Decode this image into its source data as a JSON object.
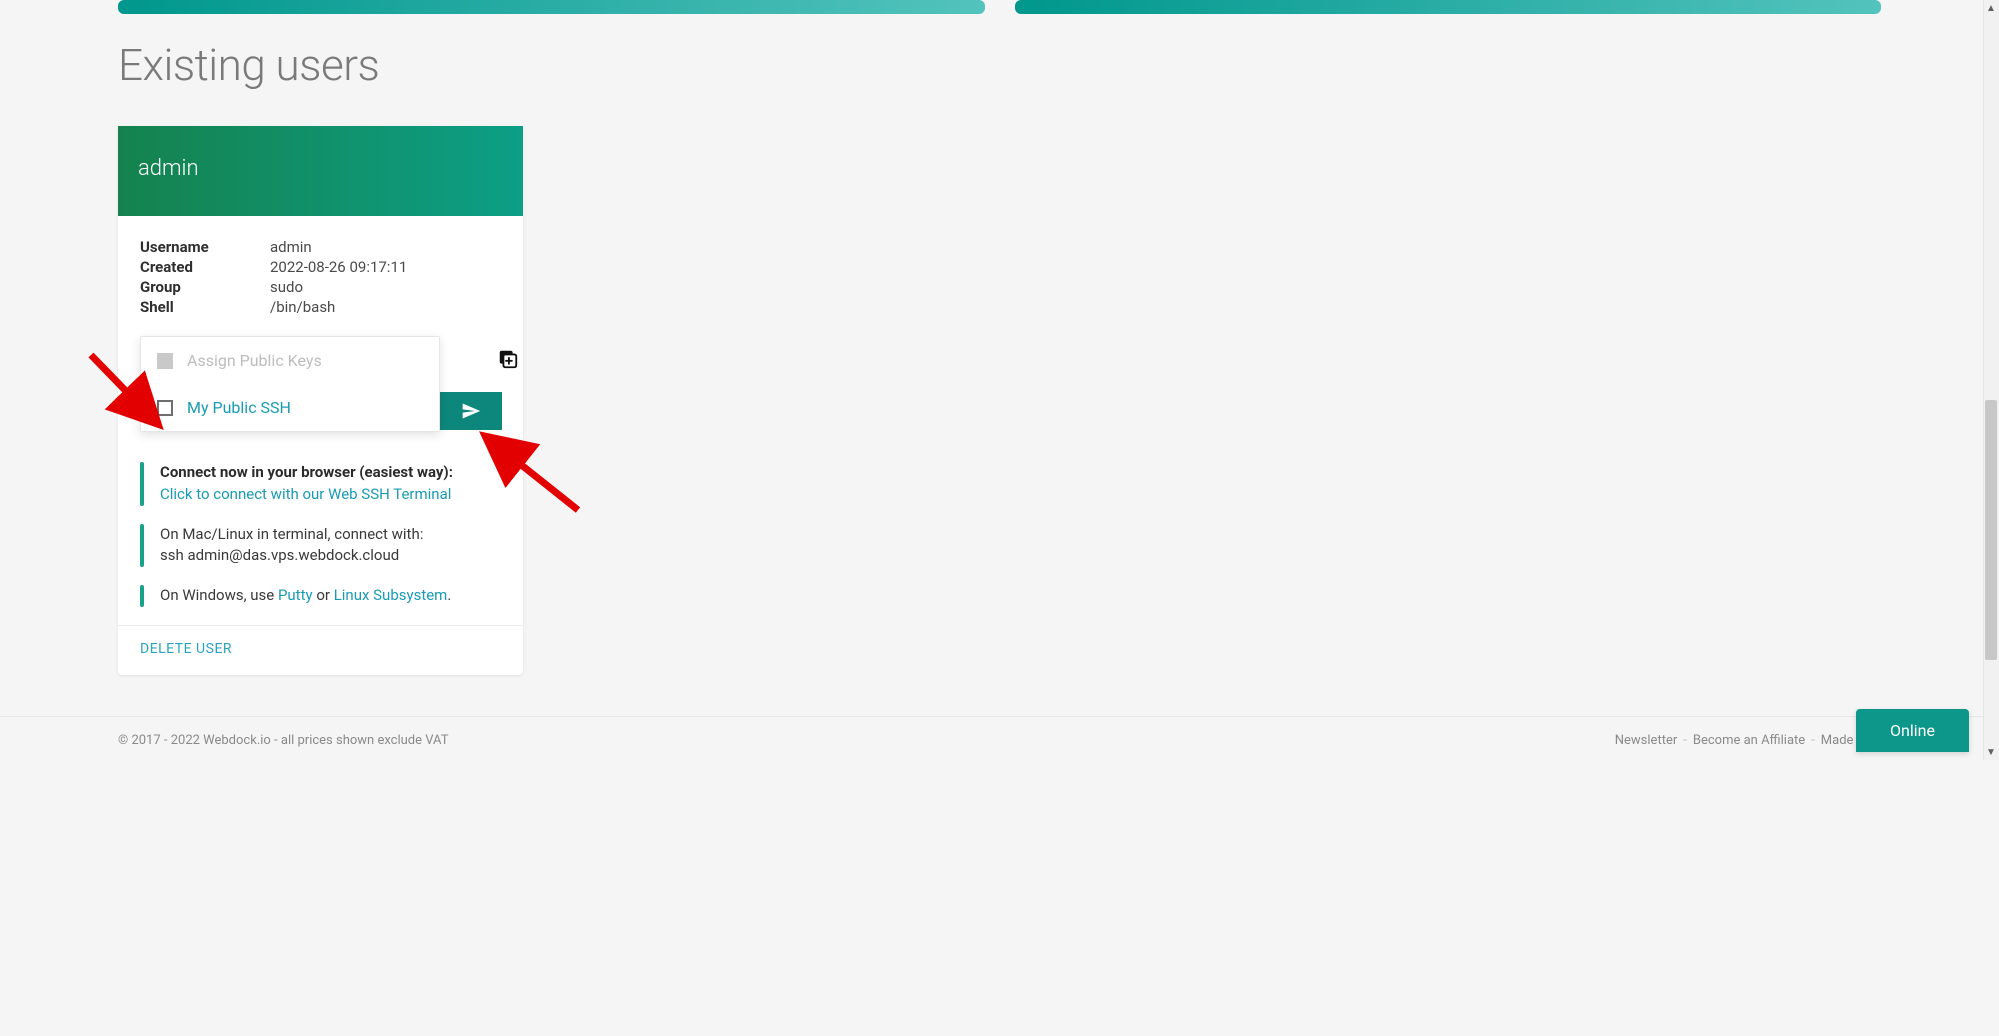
{
  "section_title": "Existing users",
  "user": {
    "name": "admin",
    "fields": {
      "username_label": "Username",
      "username_value": "admin",
      "created_label": "Created",
      "created_value": "2022-08-26 09:17:11",
      "group_label": "Group",
      "group_value": "sudo",
      "shell_label": "Shell",
      "shell_value": "/bin/bash"
    },
    "keys": {
      "placeholder": "Assign Public Keys",
      "options": [
        {
          "label": "My Public SSH",
          "checked": false
        }
      ]
    },
    "connect": {
      "browser_title": "Connect now in your browser (easiest way):",
      "browser_link": "Click to connect with our Web SSH Terminal",
      "mac_linux_line1": "On Mac/Linux in terminal, connect with:",
      "mac_linux_line2": "ssh admin@das.vps.webdock.cloud",
      "windows_prefix": "On Windows, use ",
      "windows_link1": "Putty",
      "windows_mid": " or ",
      "windows_link2": "Linux Subsystem",
      "windows_suffix": "."
    },
    "delete_label": "DELETE USER"
  },
  "footer": {
    "copyright": "© 2017 - 2022 Webdock.io - all prices shown exclude VAT",
    "newsletter": "Newsletter",
    "affiliate": "Become an Affiliate",
    "made_with": "Made with"
  },
  "online_label": "Online"
}
